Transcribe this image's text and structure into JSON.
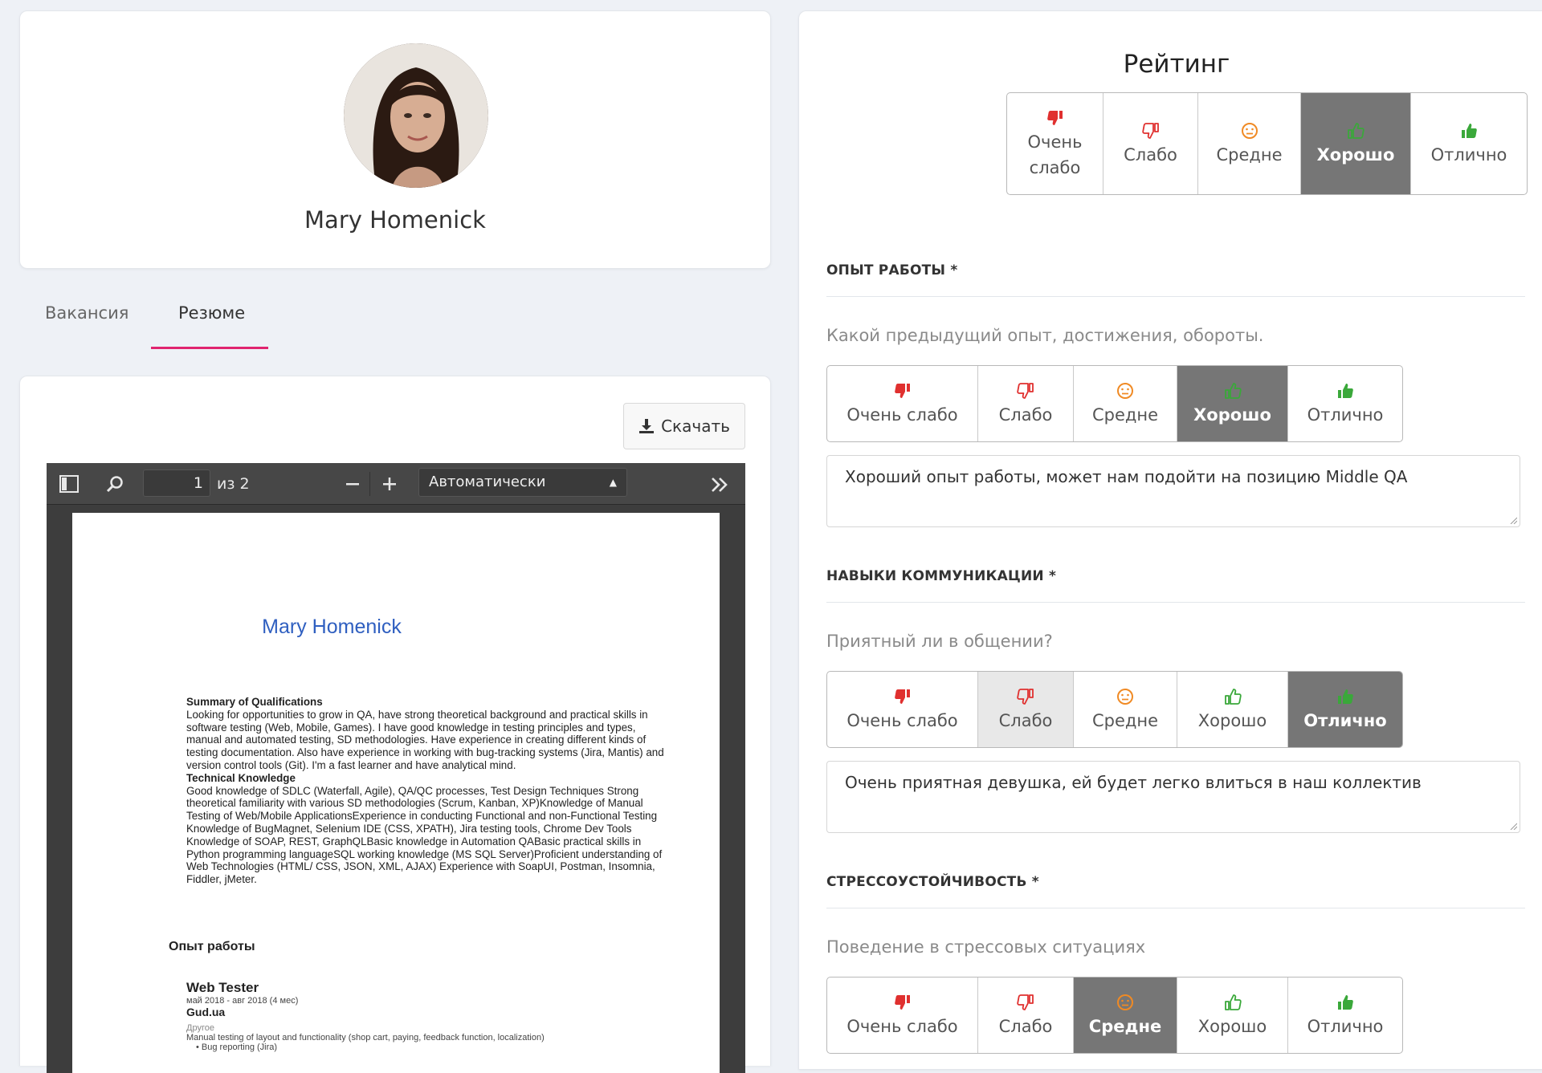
{
  "profile": {
    "name": "Mary Homenick"
  },
  "tabs": [
    {
      "label": "Вакансия"
    },
    {
      "label": "Резюме"
    }
  ],
  "resume": {
    "download_label": "Скачать",
    "viewer": {
      "page_current": "1",
      "page_total": "из 2",
      "zoom": "Автоматически"
    },
    "pdf": {
      "name": "Mary Homenick",
      "summary_heading": "Summary of Qualifications",
      "summary_text": "Looking for opportunities to grow in QA, have strong theoretical background and practical skills in software testing (Web, Mobile, Games). I have good knowledge in testing principles and types, manual and automated testing, SD methodologies. Have experience in creating different kinds of testing documentation. Also have experience in working with bug-tracking systems (Jira, Mantis) and version control tools (Git). I'm a fast learner and have analytical mind.",
      "tech_heading": "Technical Knowledge",
      "tech_text": "Good knowledge of SDLC (Waterfall, Agile), QA/QC processes, Test Design Techniques Strong theoretical familiarity with various SD methodologies (Scrum, Kanban, XP)Knowledge of Manual Testing of Web/Mobile ApplicationsExperience in conducting Functional and non-Functional Testing Knowledge of BugMagnet, Selenium IDE (CSS, XPATH), Jira testing tools, Chrome Dev Tools Knowledge of SOAP, REST, GraphQLBasic knowledge in Automation QABasic practical skills in Python programming languageSQL working knowledge (MS SQL Server)Proficient understanding of Web Technologies (HTML/ CSS, JSON, XML, AJAX) Experience with SoapUI, Postman, Insomnia, Fiddler, jMeter.",
      "experience_heading": "Опыт работы",
      "job_title": "Web Tester",
      "job_period": "май 2018 - авг 2018 (4 мес)",
      "job_company": "Gud.ua",
      "job_type": "Другое",
      "job_desc": "Manual testing of layout and functionality (shop cart, paying, feedback function, localization)",
      "job_bullet": "Bug reporting (Jira)"
    }
  },
  "rating": {
    "title": "Рейтинг",
    "options": [
      "Очень слабо",
      "Слабо",
      "Средне",
      "Хорошо",
      "Отлично"
    ],
    "overall_options": [
      "Очень слабо",
      "Слабо",
      "Средне",
      "Хорошо",
      "Отлично"
    ],
    "overall_selected": 3,
    "colors": {
      "red": "#e0302f",
      "orange": "#f08a24",
      "green": "#3aa83a"
    }
  },
  "sections": [
    {
      "label": "ОПЫТ РАБОТЫ *",
      "hint": "Какой предыдущий опыт, достижения, обороты.",
      "selected": 3,
      "comment": "Хороший опыт работы, может нам подойти на позицию Middle QA"
    },
    {
      "label": "НАВЫКИ КОММУНИКАЦИИ *",
      "hint": "Приятный ли в общении?",
      "selected": 4,
      "hovered": 1,
      "comment": "Очень приятная девушка, ей будет легко влиться в наш коллектив"
    },
    {
      "label": "СТРЕССОУСТОЙЧИВОСТЬ *",
      "hint": "Поведение в стрессовых ситуациях",
      "selected": 2
    }
  ]
}
